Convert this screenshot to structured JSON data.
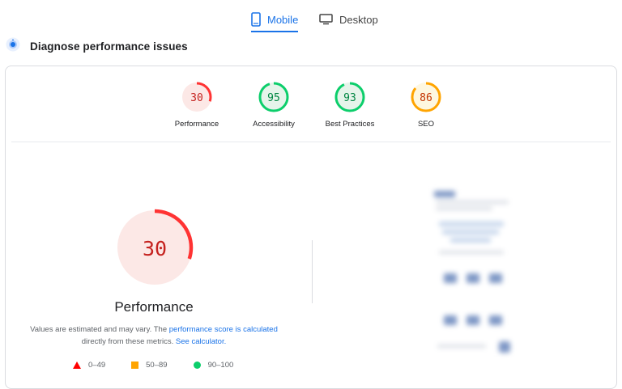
{
  "tabs": [
    {
      "label": "Mobile",
      "icon": "smartphone-icon",
      "active": true
    },
    {
      "label": "Desktop",
      "icon": "monitor-icon",
      "active": false
    }
  ],
  "header": {
    "title": "Diagnose performance issues",
    "icon": "diagnose-icon"
  },
  "categories": [
    {
      "name": "Performance",
      "score": "30",
      "value": 30,
      "color": "#ff3333",
      "track": "#fce8e6",
      "text_color": "#c5221f"
    },
    {
      "name": "Accessibility",
      "score": "95",
      "value": 95,
      "color": "#0cce6b",
      "track": "#e6f4ea",
      "text_color": "#018642"
    },
    {
      "name": "Best Practices",
      "score": "93",
      "value": 93,
      "color": "#0cce6b",
      "track": "#e6f4ea",
      "text_color": "#018642"
    },
    {
      "name": "SEO",
      "score": "86",
      "value": 86,
      "color": "#ffa400",
      "track": "#fef7e0",
      "text_color": "#c33300"
    }
  ],
  "main": {
    "score": "30",
    "value": 30,
    "title": "Performance",
    "desc_pre": "Values are estimated and may vary. The ",
    "desc_link1": "performance score is calculated",
    "desc_mid": " directly from these metrics. ",
    "desc_link2": "See calculator."
  },
  "legend": [
    {
      "range": "0–49",
      "shape": "triangle",
      "color": "#ff0000"
    },
    {
      "range": "50–89",
      "shape": "square",
      "color": "#ffa400"
    },
    {
      "range": "90–100",
      "shape": "circle",
      "color": "#0cce6b"
    }
  ]
}
